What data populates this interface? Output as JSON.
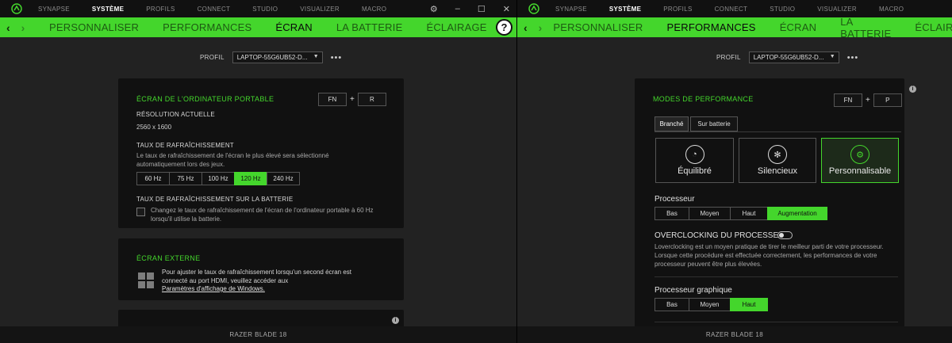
{
  "topmenu": [
    "SYNAPSE",
    "SYSTÈME",
    "PROFILS",
    "CONNECT",
    "STUDIO",
    "VISUALIZER",
    "MACRO"
  ],
  "navtabs": [
    "PERSONNALISER",
    "PERFORMANCES",
    "ÉCRAN",
    "LA BATTERIE",
    "ÉCLAIRAGE"
  ],
  "help_glyph": "?",
  "profile": {
    "label": "PROFIL",
    "value": "LAPTOP-55G6UB52-D...",
    "more": "•••"
  },
  "status": "RAZER BLADE 18",
  "left": {
    "laptop_panel": {
      "title": "ÉCRAN DE L'ORDINATEUR PORTABLE",
      "key1": "FN",
      "key2": "R",
      "plus": "+",
      "res_label": "RÉSOLUTION ACTUELLE",
      "res_value": "2560 x 1600",
      "rate_label": "TAUX DE RAFRAÎCHISSEMENT",
      "rate_desc1": "Le taux de rafraîchissement de l'écran le plus élevé sera sélectionné",
      "rate_desc2": "automatiquement lors des jeux.",
      "rates": [
        "60 Hz",
        "75 Hz",
        "100 Hz",
        "120 Hz",
        "240 Hz"
      ],
      "rate_selected": "120 Hz",
      "battery_label": "TAUX DE RAFRAÎCHISSEMENT SUR LA BATTERIE",
      "battery_desc1": "Changez le taux de rafraîchissement de l'écran de l'ordinateur portable à 60 Hz",
      "battery_desc2": "lorsqu'il utilise la batterie."
    },
    "external_panel": {
      "title": "ÉCRAN EXTERNE",
      "desc1": "Pour ajuster le taux de rafraîchissement lorsqu'un second écran est",
      "desc2": "connecté au port HDMI, veuillez accéder aux",
      "link": "Paramètres d'affichage de Windows."
    }
  },
  "right": {
    "modes_panel": {
      "title": "MODES DE PERFORMANCE",
      "key1": "FN",
      "key2": "P",
      "plus": "+",
      "subtabs": [
        "Branché",
        "Sur batterie"
      ],
      "modes": [
        {
          "label": "Équilibré",
          "icon": "gauge-icon"
        },
        {
          "label": "Silencieux",
          "icon": "fan-icon"
        },
        {
          "label": "Personnalisable",
          "icon": "gear-icon"
        }
      ],
      "selected_mode": "Personnalisable",
      "cpu_label": "Processeur",
      "cpu_levels": [
        "Bas",
        "Moyen",
        "Haut",
        "Augmentation"
      ],
      "cpu_selected": "Augmentation",
      "oc_label": "OVERCLOCKING DU PROCESSEUR",
      "oc_desc1": "Loverclocking est un moyen pratique de tirer le meilleur parti de votre processeur.",
      "oc_desc2": "Lorsque cette procédure est effectuée correctement, les performances de votre",
      "oc_desc3": "processeur peuvent être plus élevées.",
      "gpu_label": "Processeur graphique",
      "gpu_levels": [
        "Bas",
        "Moyen",
        "Haut"
      ],
      "gpu_selected": "Haut"
    }
  },
  "colors": {
    "accent": "#44d62c",
    "background": "#222222",
    "panel": "#111111"
  }
}
